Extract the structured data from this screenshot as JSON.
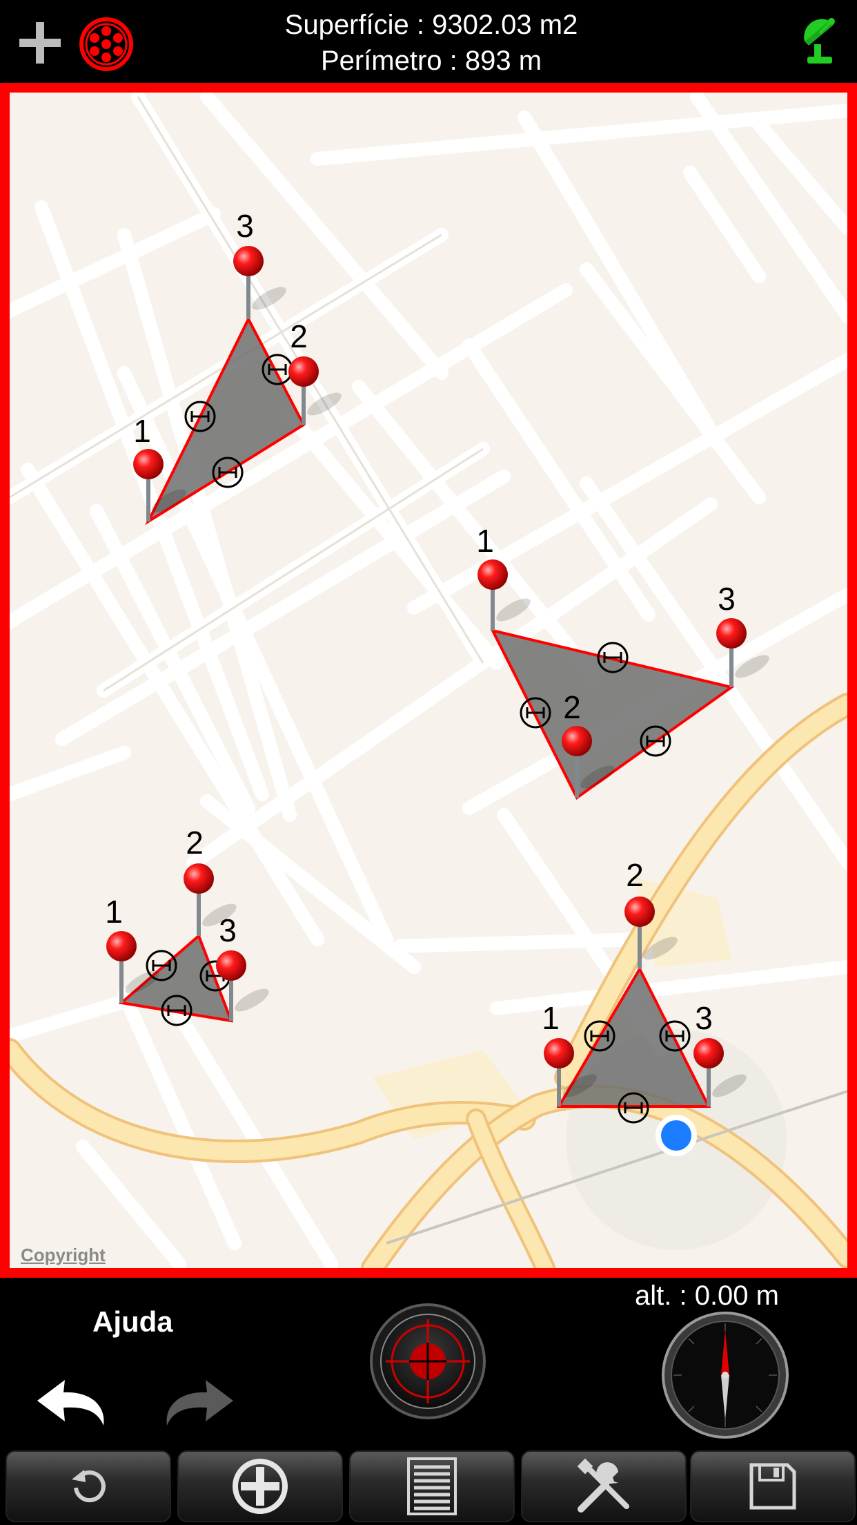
{
  "header": {
    "area_text": "Superfície : 9302.03 m2",
    "perimeter_text": "Perímetro : 893 m"
  },
  "map": {
    "copyright": "Copyright",
    "pins": [
      {
        "label": "1"
      },
      {
        "label": "2"
      },
      {
        "label": "3"
      },
      {
        "label": "1"
      },
      {
        "label": "2"
      },
      {
        "label": "3"
      },
      {
        "label": "1"
      },
      {
        "label": "2"
      },
      {
        "label": "3"
      },
      {
        "label": "1"
      },
      {
        "label": "2"
      },
      {
        "label": "3"
      }
    ]
  },
  "bottom": {
    "help_label": "Ajuda",
    "altitude_text": "alt. : 0.00 m"
  },
  "colors": {
    "frame": "#ff0000",
    "pin": "#e00000",
    "gps": "#22cc22",
    "location_dot": "#1a7cff"
  },
  "icons": {
    "add": "plus-icon",
    "mode": "target-dots-icon",
    "gps": "satellite-dish-icon",
    "undo": "undo-arrow-icon",
    "redo": "redo-arrow-icon",
    "center": "crosshair-icon",
    "compass": "compass-icon",
    "toolbar": [
      "refresh-icon",
      "locate-icon",
      "list-icon",
      "tools-icon",
      "save-icon"
    ]
  }
}
